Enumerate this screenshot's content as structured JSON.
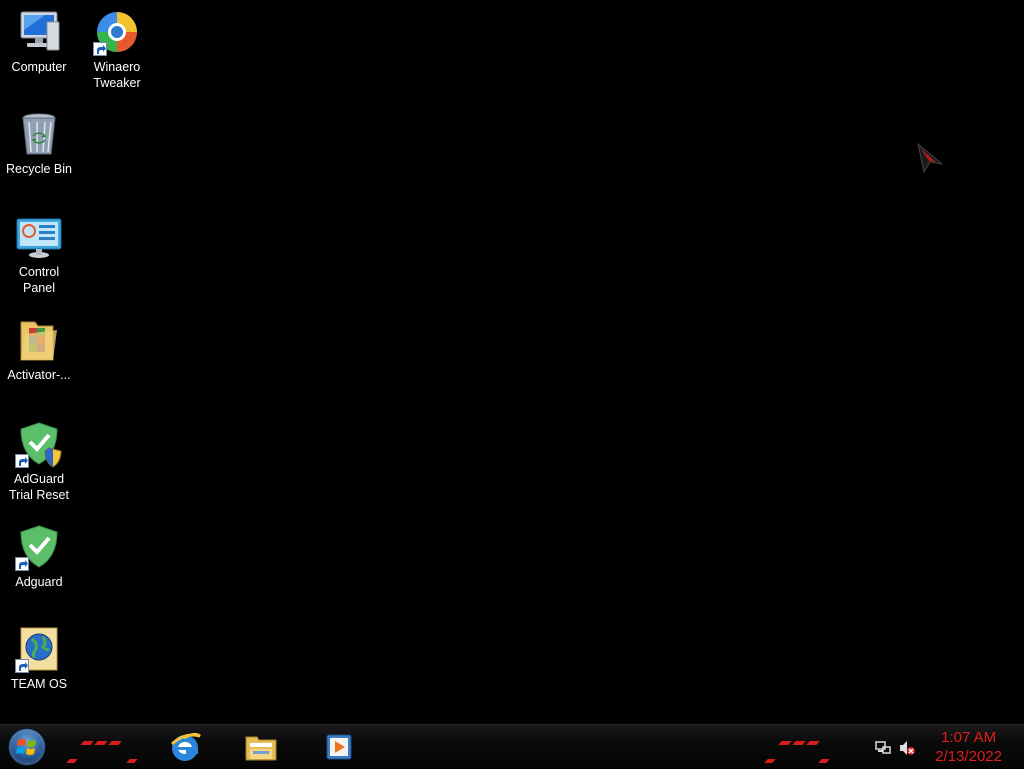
{
  "desktop": {
    "icons": [
      {
        "label": "Computer",
        "icon": "computer-icon",
        "shortcut": false
      },
      {
        "label": "Winaero\nTweaker",
        "icon": "winaero-tweaker-icon",
        "shortcut": true
      },
      {
        "label": "Recycle Bin",
        "icon": "recycle-bin-icon",
        "shortcut": false
      },
      {
        "label": "Control\nPanel",
        "icon": "control-panel-icon",
        "shortcut": false
      },
      {
        "label": "Activator-...",
        "icon": "folder-icon",
        "shortcut": false
      },
      {
        "label": "AdGuard\nTrial Reset",
        "icon": "adguard-shield-icon",
        "shortcut": true
      },
      {
        "label": "Adguard",
        "icon": "adguard-shield-icon",
        "shortcut": true
      },
      {
        "label": "TEAM OS",
        "icon": "globe-document-icon",
        "shortcut": true
      }
    ]
  },
  "taskbar": {
    "start_icon": "windows-start-orb",
    "pinned": [
      {
        "name": "Internet Explorer",
        "icon": "internet-explorer-icon"
      },
      {
        "name": "File Explorer",
        "icon": "file-explorer-folder-icon"
      },
      {
        "name": "Media Player",
        "icon": "media-player-icon"
      }
    ],
    "tray": {
      "icons": [
        "network-icon",
        "volume-muted-icon"
      ],
      "time": "1:07 AM",
      "date": "2/13/2022"
    },
    "accent_color": "#e21d1d"
  }
}
